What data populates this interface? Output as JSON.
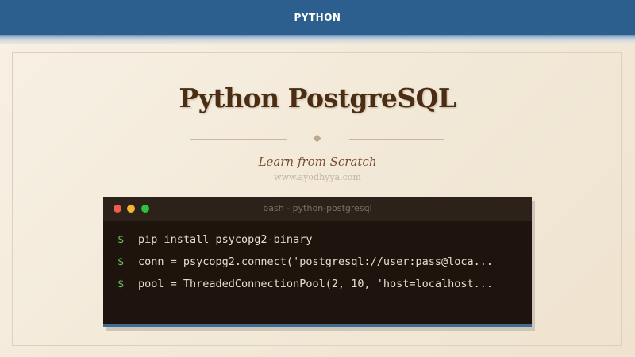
{
  "header": {
    "label": "PYTHON"
  },
  "hero": {
    "title": "Python PostgreSQL",
    "subtitle": "Learn from Scratch",
    "url": "www.ayodhyya.com"
  },
  "terminal": {
    "title": "bash - python-postgresql",
    "prompt": "$",
    "commands": [
      "pip install psycopg2-binary",
      "conn = psycopg2.connect('postgresql://user:pass@loca...",
      "pool = ThreadedConnectionPool(2, 10, 'host=localhost..."
    ]
  },
  "colors": {
    "header_bg": "#2d5f8e",
    "title_text": "#4b2d14",
    "subtitle_text": "#7a4f2d",
    "terminal_bg": "#1e140d",
    "prompt_green": "#6dc25a"
  }
}
